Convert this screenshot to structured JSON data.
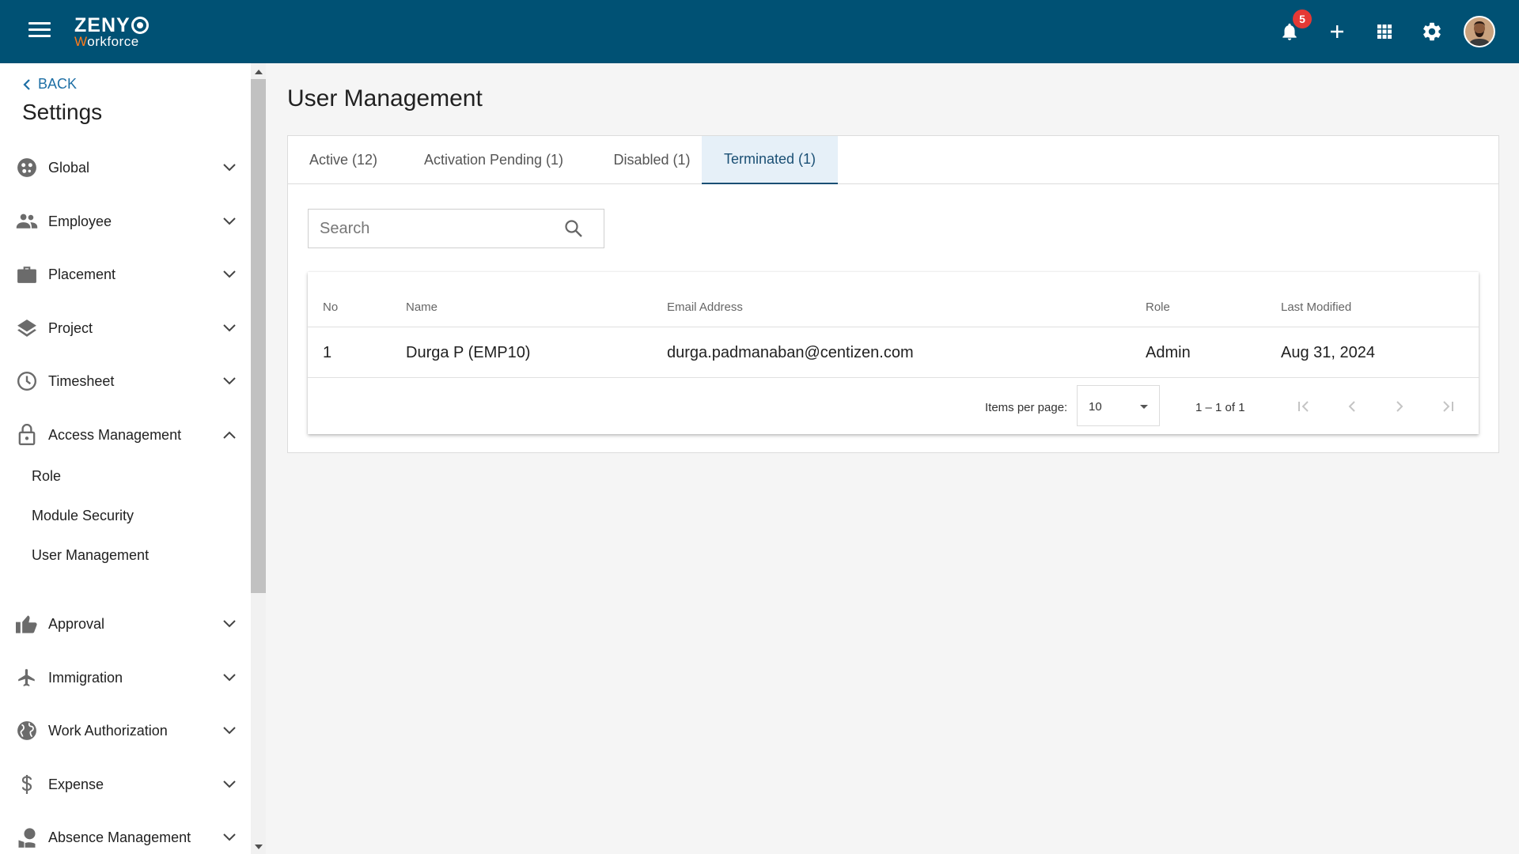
{
  "app": {
    "logo_top": "ZENY",
    "logo_bottom_first": "W",
    "logo_bottom_rest": "orkforce",
    "brand_color": "#005174",
    "accent_color": "#ff7a1a"
  },
  "topbar": {
    "notification_count": "5",
    "icons": [
      "menu-icon",
      "bell-icon",
      "plus-icon",
      "apps-grid-icon",
      "gear-icon",
      "avatar"
    ]
  },
  "sidebar": {
    "back_label": "BACK",
    "title": "Settings",
    "items": [
      {
        "label": "Global",
        "icon": "globe-icon",
        "expanded": false
      },
      {
        "label": "Employee",
        "icon": "people-icon",
        "expanded": false
      },
      {
        "label": "Placement",
        "icon": "briefcase-icon",
        "expanded": false
      },
      {
        "label": "Project",
        "icon": "layers-icon",
        "expanded": false
      },
      {
        "label": "Timesheet",
        "icon": "clock-icon",
        "expanded": false
      },
      {
        "label": "Access Management",
        "icon": "lock-icon",
        "expanded": true
      },
      {
        "label": "Approval",
        "icon": "thumbs-up-icon",
        "expanded": false
      },
      {
        "label": "Immigration",
        "icon": "airplane-icon",
        "expanded": false
      },
      {
        "label": "Work Authorization",
        "icon": "public-globe-icon",
        "expanded": false
      },
      {
        "label": "Expense",
        "icon": "dollar-icon",
        "expanded": false
      },
      {
        "label": "Absence Management",
        "icon": "person-leave-icon",
        "expanded": false
      }
    ],
    "sub_items": [
      "Role",
      "Module Security",
      "User Management"
    ]
  },
  "main": {
    "title": "User Management",
    "tabs": [
      {
        "label": "Active (12)",
        "active": false
      },
      {
        "label": "Activation Pending (1)",
        "active": false
      },
      {
        "label": "Disabled (1)",
        "active": false
      },
      {
        "label": "Terminated (1)",
        "active": true
      }
    ],
    "search": {
      "placeholder": "Search",
      "value": ""
    },
    "table": {
      "columns": [
        "No",
        "Name",
        "Email Address",
        "Role",
        "Last Modified"
      ],
      "rows": [
        {
          "no": "1",
          "name": "Durga P (EMP10)",
          "email": "durga.padmanaban@centizen.com",
          "role": "Admin",
          "last_modified": "Aug 31, 2024"
        }
      ]
    },
    "paginator": {
      "items_per_page_label": "Items per page:",
      "items_per_page": "10",
      "range": "1 – 1 of 1"
    }
  }
}
